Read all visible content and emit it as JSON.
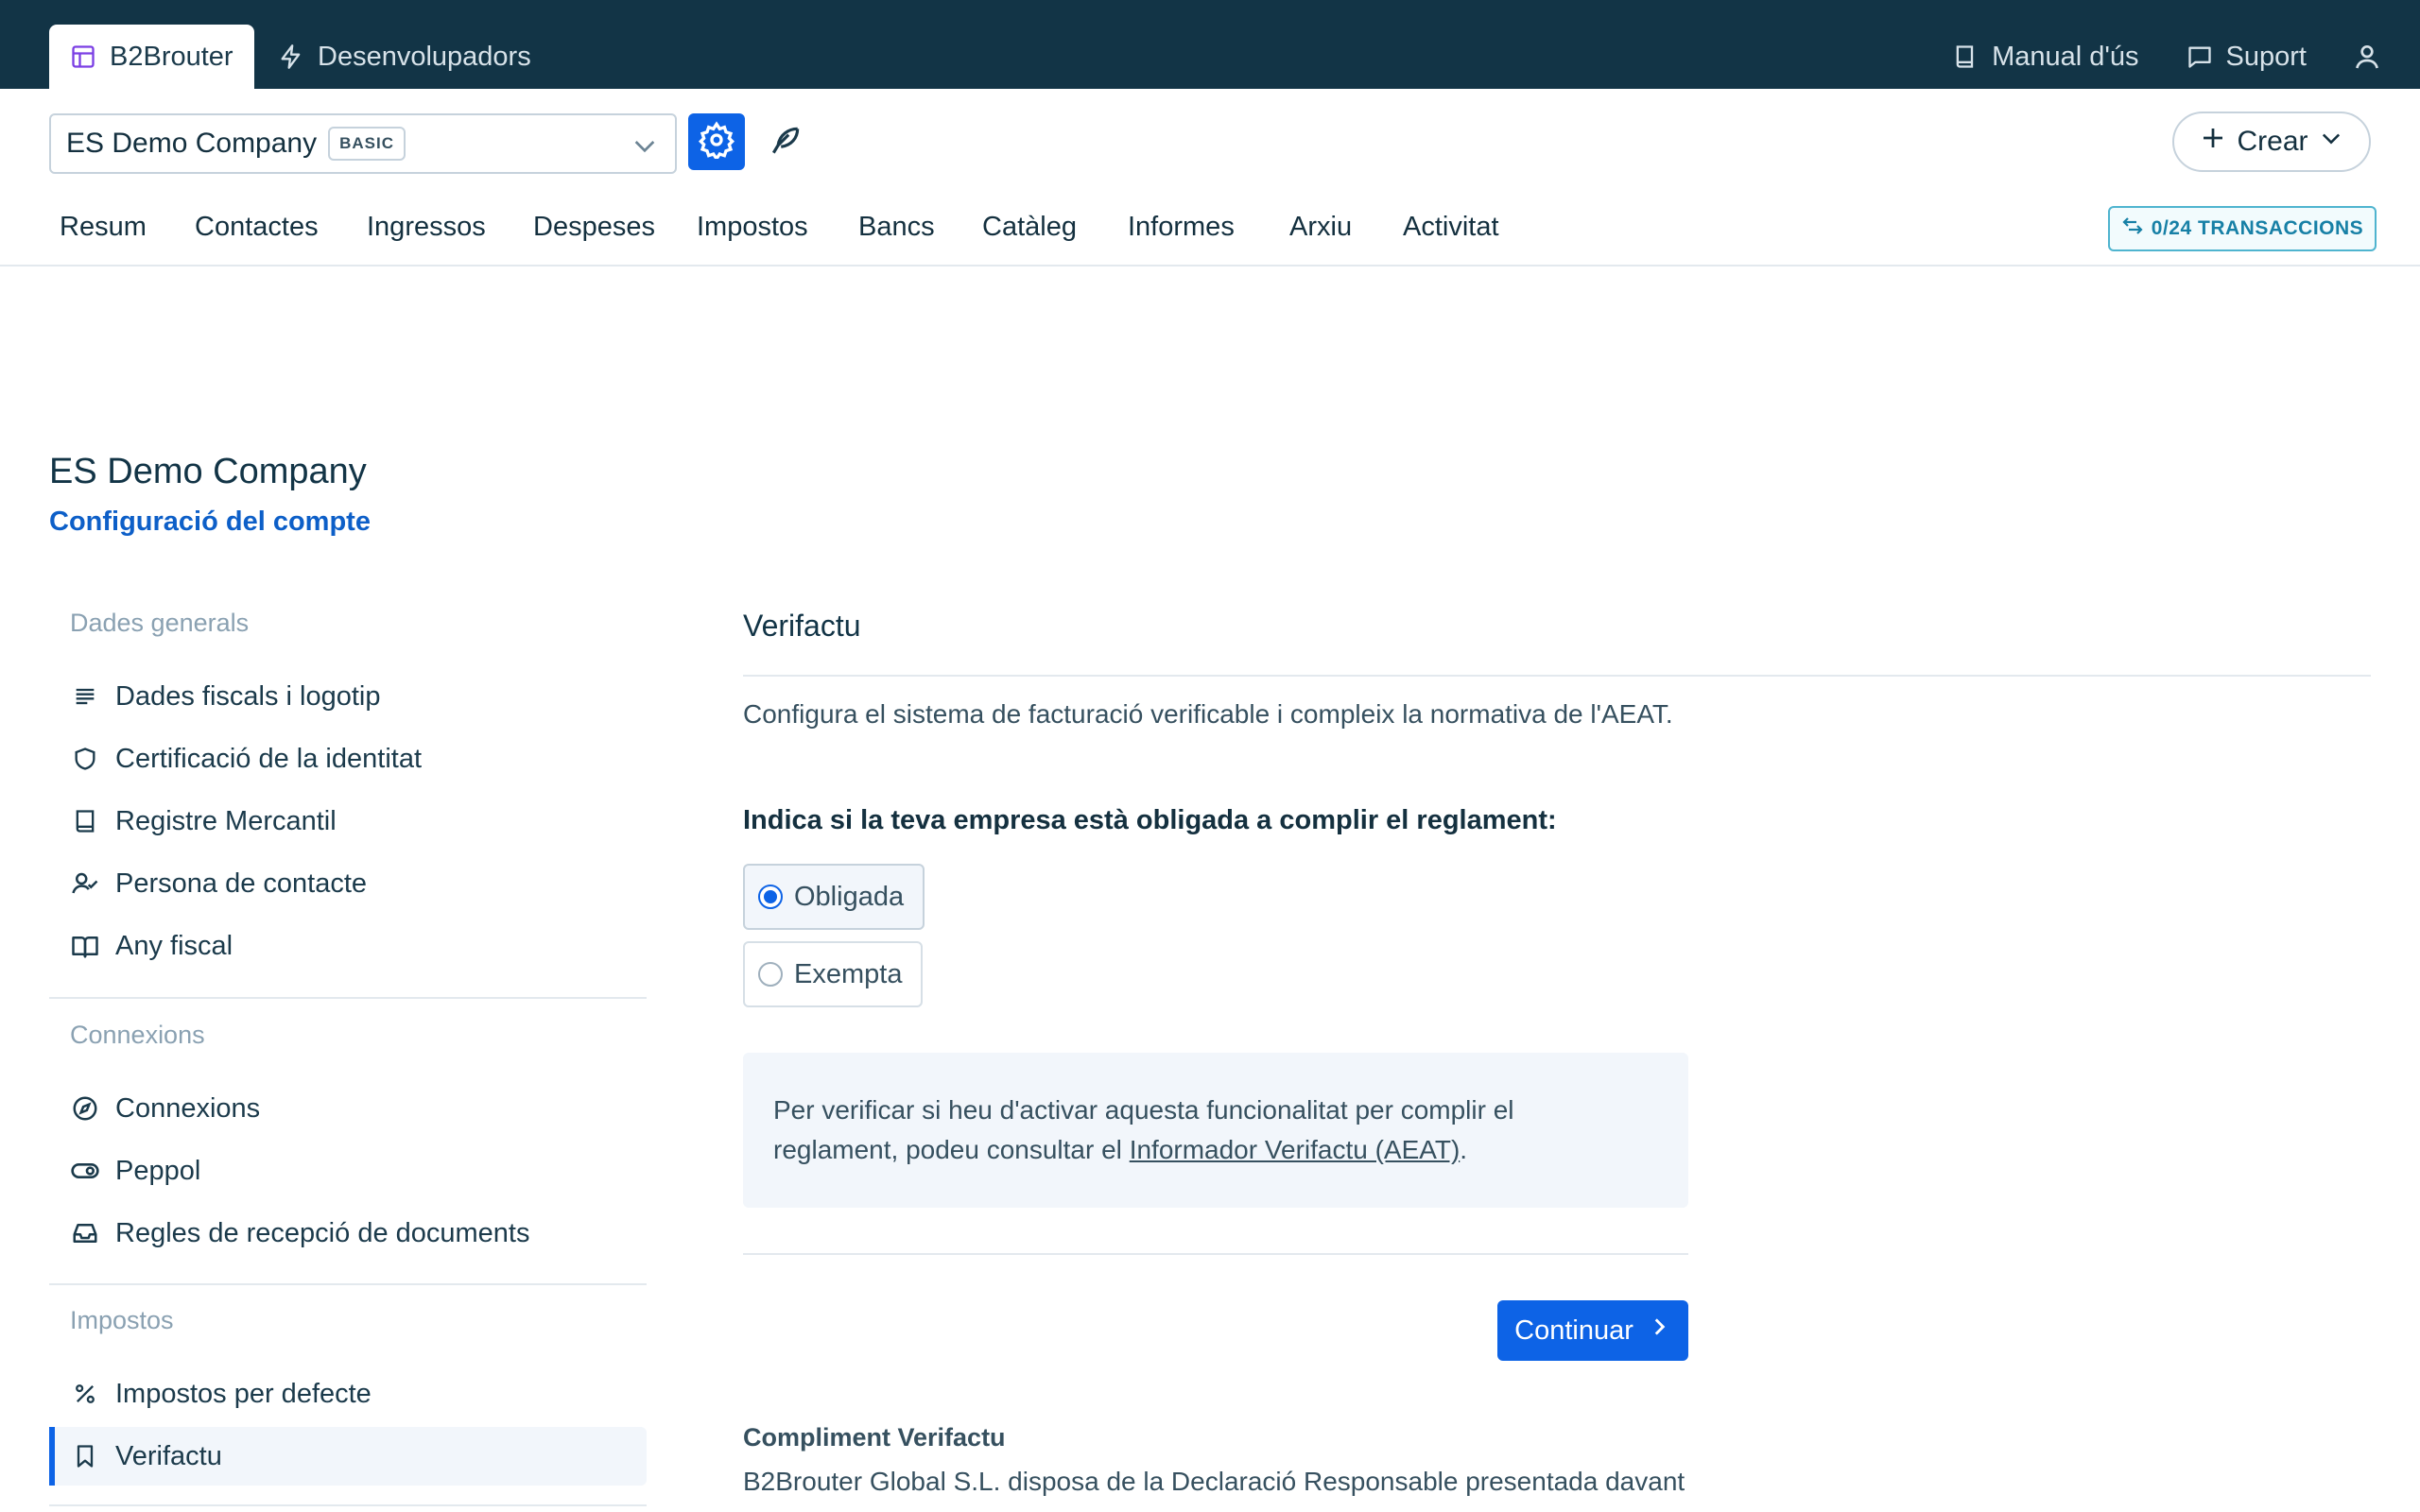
{
  "topbar": {
    "brand_tab": "B2Brouter",
    "dev_tab": "Desenvolupadors",
    "manual": "Manual d'ús",
    "support": "Suport"
  },
  "company_bar": {
    "company_name": "ES Demo Company",
    "plan_badge": "BASIC",
    "create_label": "Crear"
  },
  "mainnav": {
    "tabs": [
      "Resum",
      "Contactes",
      "Ingressos",
      "Despeses",
      "Impostos",
      "Bancs",
      "Catàleg",
      "Informes",
      "Arxiu",
      "Activitat"
    ],
    "transactions_badge": "0/24 TRANSACCIONS"
  },
  "page": {
    "title": "ES Demo Company",
    "subtitle": "Configuració del compte"
  },
  "sidebar": {
    "sections": [
      {
        "title": "Dades generals",
        "items": [
          {
            "label": "Dades fiscals i logotip",
            "icon": "lines-icon"
          },
          {
            "label": "Certificació de la identitat",
            "icon": "shield-icon"
          },
          {
            "label": "Registre Mercantil",
            "icon": "book-icon"
          },
          {
            "label": "Persona de contacte",
            "icon": "user-check-icon"
          },
          {
            "label": "Any fiscal",
            "icon": "open-book-icon"
          }
        ]
      },
      {
        "title": "Connexions",
        "items": [
          {
            "label": "Connexions",
            "icon": "compass-icon"
          },
          {
            "label": "Peppol",
            "icon": "toggle-icon"
          },
          {
            "label": "Regles de recepció de documents",
            "icon": "inbox-icon"
          }
        ]
      },
      {
        "title": "Impostos",
        "items": [
          {
            "label": "Impostos per defecte",
            "icon": "percent-icon"
          },
          {
            "label": "Verifactu",
            "icon": "bookmark-icon",
            "active": true
          }
        ]
      }
    ]
  },
  "content": {
    "section_title": "Verifactu",
    "intro": "Configura el sistema de facturació verificable i compleix la normativa de l'AEAT.",
    "question": "Indica si la teva empresa està obligada a complir el reglament:",
    "options": [
      {
        "label": "Obligada",
        "selected": true
      },
      {
        "label": "Exempta",
        "selected": false
      }
    ],
    "info_line1": "Per verificar si heu d'activar aquesta funcionalitat per complir el",
    "info_line2_prefix": "reglament, podeu consultar el ",
    "info_link": "Informador Verifactu (AEAT)",
    "info_suffix": ".",
    "continue_label": "Continuar",
    "compliance_title": "Compliment Verifactu",
    "compliance_text": "B2Brouter Global S.L. disposa de la Declaració Responsable presentada davant"
  },
  "colors": {
    "topbar_bg": "#123446",
    "accent": "#0d63e6",
    "link": "#0d5fc8",
    "info_bg": "#f2f6fb"
  }
}
